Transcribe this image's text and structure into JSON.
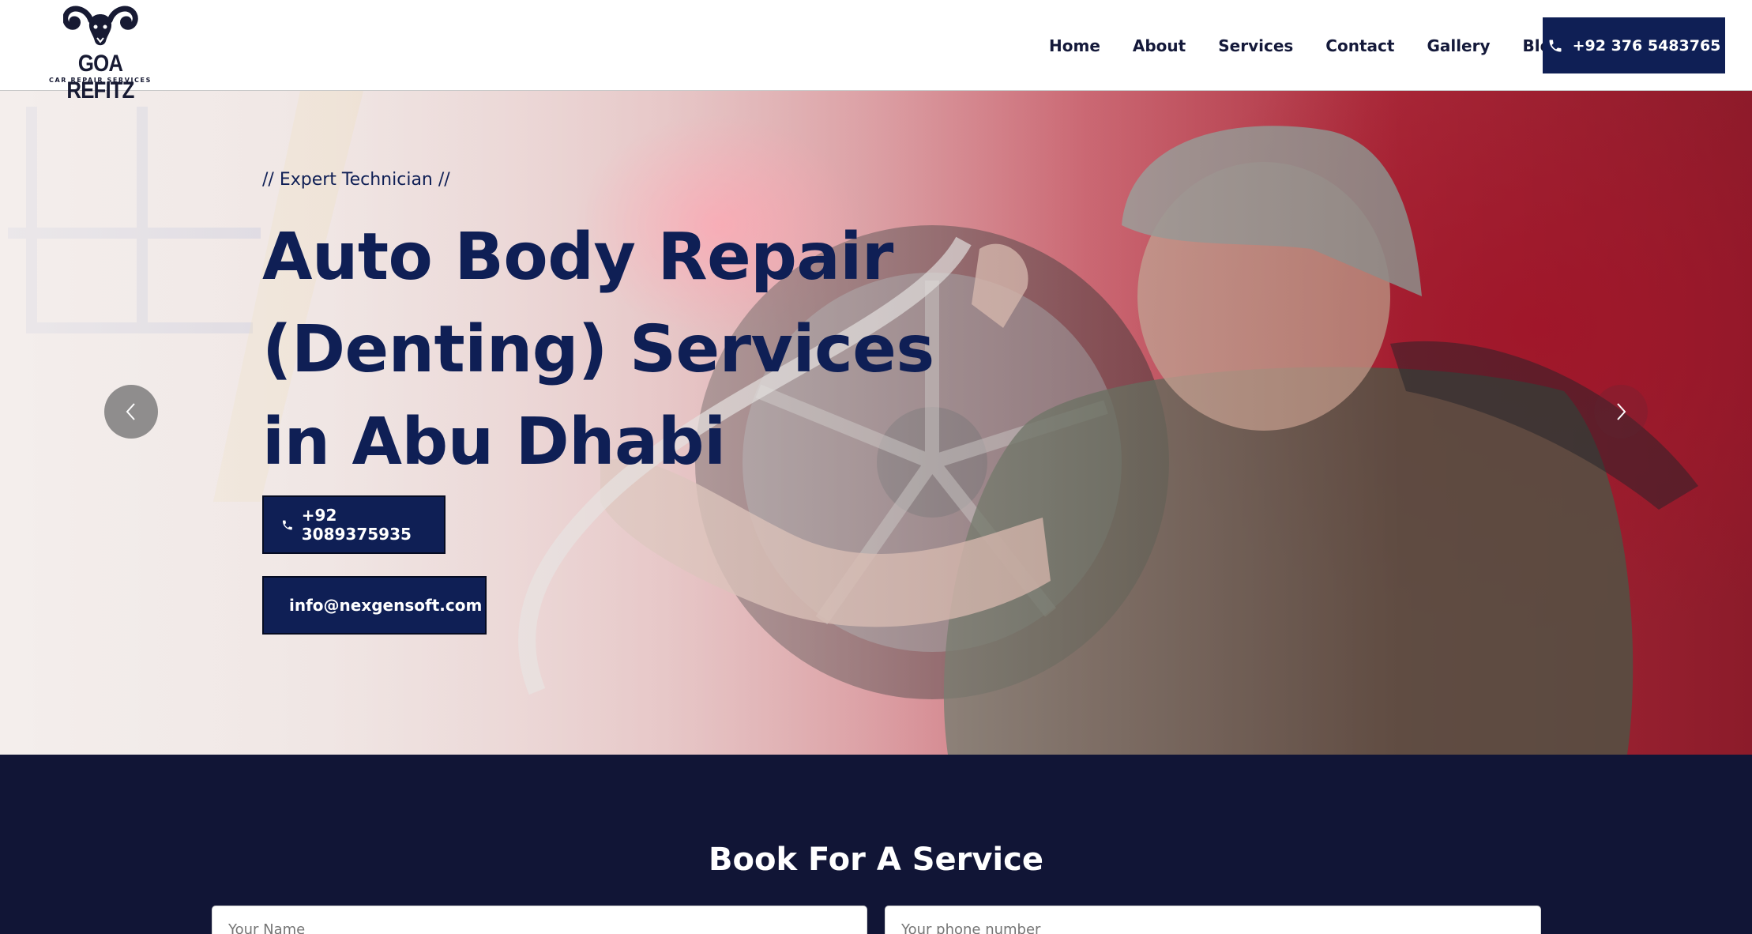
{
  "brand": {
    "name": "GOA REFITZ",
    "tagline": "CAR REPAIR SERVICES"
  },
  "nav": {
    "items": [
      "Home",
      "About",
      "Services",
      "Contact",
      "Gallery",
      "Blog"
    ],
    "phone": "+92 376 5483765"
  },
  "hero": {
    "eyebrow": "// Expert Technician //",
    "title": "Auto Body Repair (Denting) Services in Abu Dhabi",
    "phone": "+92 3089375935",
    "email": "info@nexgensoft.com"
  },
  "booking": {
    "title": "Book For A Service",
    "name_placeholder": "Your Name",
    "phone_placeholder": "Your phone number"
  },
  "colors": {
    "brand_navy": "#0f1f55",
    "footer_navy": "#111536",
    "text_dark": "#14193a"
  },
  "icons": [
    "phone-icon",
    "envelope-icon",
    "chevron-left-icon",
    "chevron-right-icon",
    "ram-logo-icon"
  ]
}
